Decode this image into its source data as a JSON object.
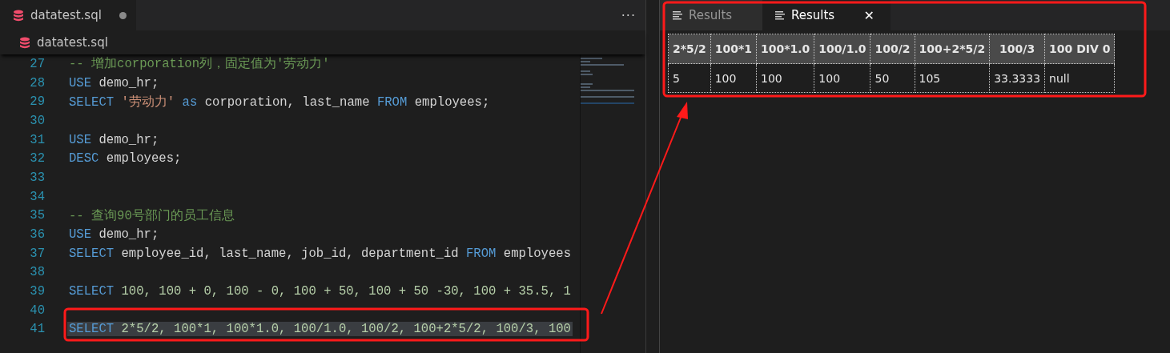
{
  "editor_tab": {
    "title": "datatest.sql",
    "dirty": true,
    "more": "···"
  },
  "breadcrumb": "datatest.sql",
  "code_lines": [
    {
      "number": "27",
      "selected": false,
      "tokens": [
        {
          "kind": "comment",
          "text": "-- 增加corporation列，固定值为'劳动力'"
        }
      ]
    },
    {
      "number": "28",
      "selected": false,
      "tokens": [
        {
          "kind": "keyword",
          "text": "USE"
        },
        {
          "kind": "plain",
          "text": " demo_hr;"
        }
      ]
    },
    {
      "number": "29",
      "selected": false,
      "tokens": [
        {
          "kind": "keyword",
          "text": "SELECT"
        },
        {
          "kind": "string",
          "text": " '劳动力'"
        },
        {
          "kind": "keyword",
          "text": " as"
        },
        {
          "kind": "plain",
          "text": " corporation, last_name "
        },
        {
          "kind": "keyword",
          "text": "FROM"
        },
        {
          "kind": "plain",
          "text": " employees;"
        }
      ]
    },
    {
      "number": "30",
      "selected": false
    },
    {
      "number": "31",
      "selected": false,
      "tokens": [
        {
          "kind": "keyword",
          "text": "USE"
        },
        {
          "kind": "plain",
          "text": " demo_hr;"
        }
      ]
    },
    {
      "number": "32",
      "selected": false,
      "tokens": [
        {
          "kind": "keyword",
          "text": "DESC"
        },
        {
          "kind": "plain",
          "text": " employees;"
        }
      ]
    },
    {
      "number": "33",
      "selected": false
    },
    {
      "number": "34",
      "selected": false
    },
    {
      "number": "35",
      "selected": false,
      "tokens": [
        {
          "kind": "comment",
          "text": "-- 查询90号部门的员工信息"
        }
      ]
    },
    {
      "number": "36",
      "selected": false,
      "tokens": [
        {
          "kind": "keyword",
          "text": "USE"
        },
        {
          "kind": "plain",
          "text": " demo_hr;"
        }
      ]
    },
    {
      "number": "37",
      "selected": false,
      "tokens": [
        {
          "kind": "keyword",
          "text": "SELECT"
        },
        {
          "kind": "plain",
          "text": " employee_id, last_name, job_id, department_id "
        },
        {
          "kind": "keyword",
          "text": "FROM"
        },
        {
          "kind": "plain",
          "text": " employees"
        }
      ]
    },
    {
      "number": "38",
      "selected": false
    },
    {
      "number": "39",
      "selected": false,
      "tokens": [
        {
          "kind": "keyword",
          "text": "SELECT"
        },
        {
          "kind": "number",
          "text": " 100, 100 + 0, 100 - 0, 100 + 50, 100 + 50 -30, 100 + 35.5, 1"
        }
      ]
    },
    {
      "number": "40",
      "selected": false
    },
    {
      "number": "41",
      "selected": true,
      "tokens": [
        {
          "kind": "keyword",
          "text": "SELECT"
        },
        {
          "kind": "number",
          "text": " 2*5/2, 100*1, 100*1.0, 100/1.0, 100/2, 100+2*5/2, 100/3, 100"
        }
      ]
    }
  ],
  "results_tabs": [
    {
      "label": "Results",
      "selected": false
    },
    {
      "label": "Results",
      "selected": true,
      "close": "✕"
    }
  ],
  "table": {
    "columns": [
      "2*5/2",
      "100*1",
      "100*1.0",
      "100/1.0",
      "100/2",
      "100+2*5/2",
      "100/3",
      "100 DIV 0"
    ],
    "rows": [
      [
        "5",
        "100",
        "100",
        "100",
        "50",
        "105",
        "33.3333",
        "null"
      ]
    ]
  }
}
